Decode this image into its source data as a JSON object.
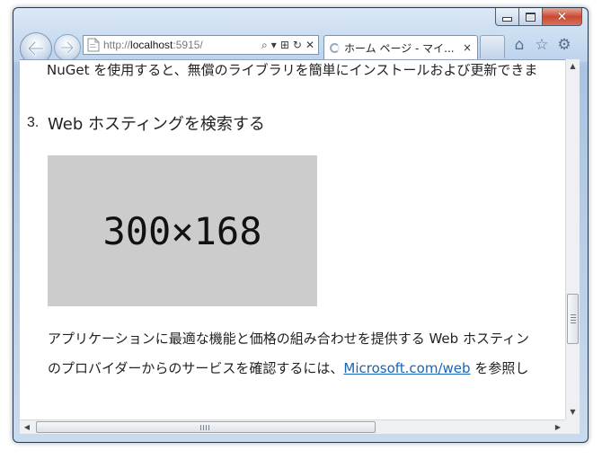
{
  "browser": {
    "address": {
      "prefix": "http://",
      "host": "localhost",
      "suffix": ":5915/"
    },
    "tab": {
      "title": "ホーム ページ - マイ...",
      "close": "×"
    },
    "nav": {
      "back_icon": "arrow-left-icon",
      "forward_icon": "arrow-right-icon"
    },
    "toolbar_icons": [
      "home-icon",
      "star-icon",
      "gear-icon"
    ],
    "address_tools": {
      "search": "⌕",
      "dropdown": "▾",
      "compat": "⊞",
      "refresh": "↻",
      "stop": "✕"
    },
    "caption": {
      "close": "✕"
    }
  },
  "content": {
    "line1": "NuGet を使用すると、無償のライブラリを簡単にインストールおよび更新できま",
    "heading_number": "3.",
    "heading": "Web ホスティングを検索する",
    "placeholder_text": "300×168",
    "para1": "アプリケーションに最適な機能と価格の組み合わせを提供する Web ホスティン",
    "para2_before": "のプロバイダーからのサービスを確認するには、",
    "para2_link": "Microsoft.com/web",
    "para2_after": " を参照し"
  },
  "scrollbars": {
    "vertical_position": 0.85,
    "horizontal_position": 0.0
  },
  "colors": {
    "link": "#1a64b4",
    "placeholder_bg": "#cccccc",
    "close_button": "#c94a33"
  }
}
